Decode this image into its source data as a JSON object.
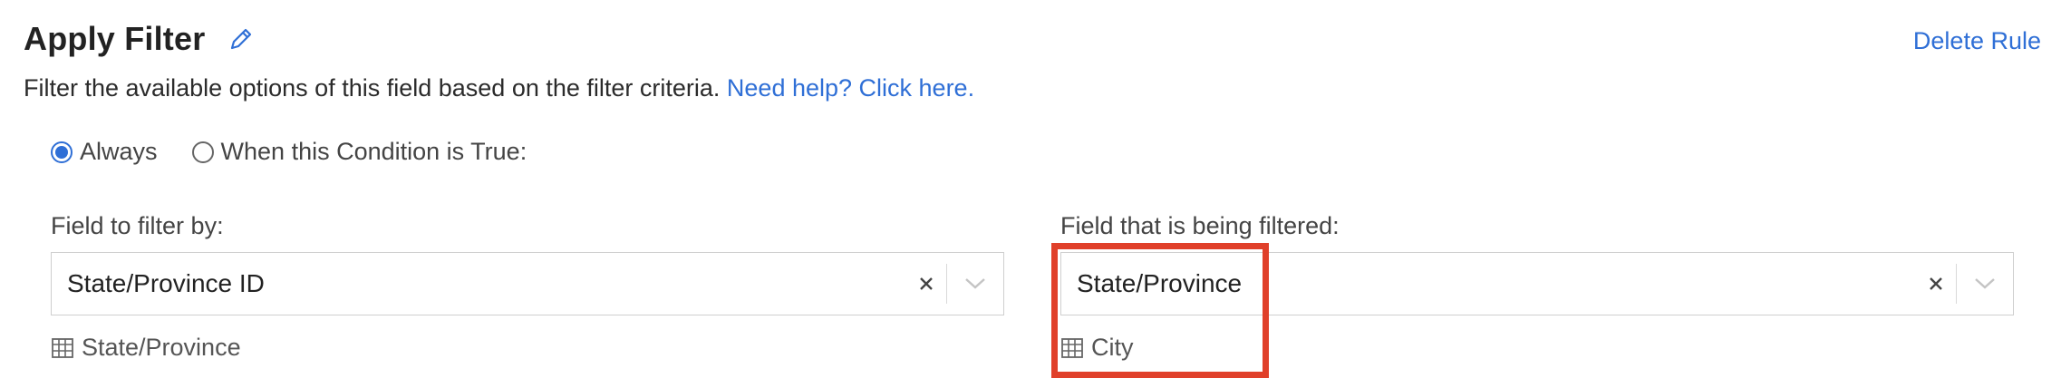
{
  "header": {
    "title": "Apply Filter",
    "edit_icon": "pencil-icon",
    "delete_label": "Delete Rule"
  },
  "description": {
    "text": "Filter the available options of this field based on the filter criteria.",
    "help_link": "Need help? Click here."
  },
  "condition": {
    "options": [
      {
        "label": "Always",
        "checked": true
      },
      {
        "label": "When this Condition is True:",
        "checked": false
      }
    ]
  },
  "filter_by": {
    "label": "Field to filter by:",
    "value": "State/Province ID",
    "table_name": "State/Province",
    "table_icon": "table-icon"
  },
  "filtered": {
    "label": "Field that is being filtered:",
    "value": "State/Province",
    "table_name": "City",
    "table_icon": "table-icon"
  },
  "colors": {
    "accent": "#2f6fd6",
    "highlight": "#e0402a"
  }
}
